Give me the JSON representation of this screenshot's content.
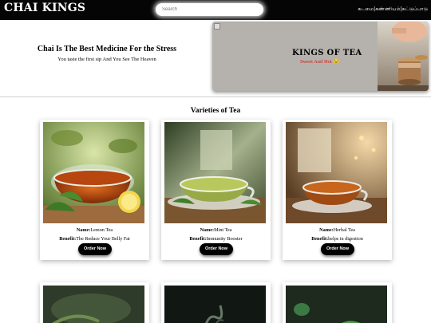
{
  "nav": {
    "brand": "CHAI KINGS",
    "search_placeholder": "Search",
    "links": [
      "கடமை",
      "கண்ணியம்",
      "கட்டுப்பாடு"
    ],
    "separator": "|"
  },
  "hero": {
    "title": "Chai Is The Best Medicine For the Stress",
    "subtitle": "You taste the first sip And You See The Heaven",
    "banner_title": "KINGS OF TEA",
    "banner_subtitle": "Sweet And Hot 😉"
  },
  "section": {
    "title": "Varieties of Tea"
  },
  "labels": {
    "name": "Name:",
    "benefit": "Benefit:",
    "order": "Order Now"
  },
  "teas": [
    {
      "name": "Lemon Tea",
      "benefit": "The Reduce Your Belly Fat",
      "image": "lemon-tea-photo"
    },
    {
      "name": "Mint Tea",
      "benefit": "Immunity Booster",
      "image": "mint-tea-photo"
    },
    {
      "name": "Herbal Tea",
      "benefit": "helps in digestion",
      "image": "herbal-tea-photo"
    }
  ],
  "colors": {
    "nav_bg": "#050505",
    "banner_bg": "#b5b2ad",
    "banner_accent": "#d01616",
    "button_bg": "#000000"
  }
}
